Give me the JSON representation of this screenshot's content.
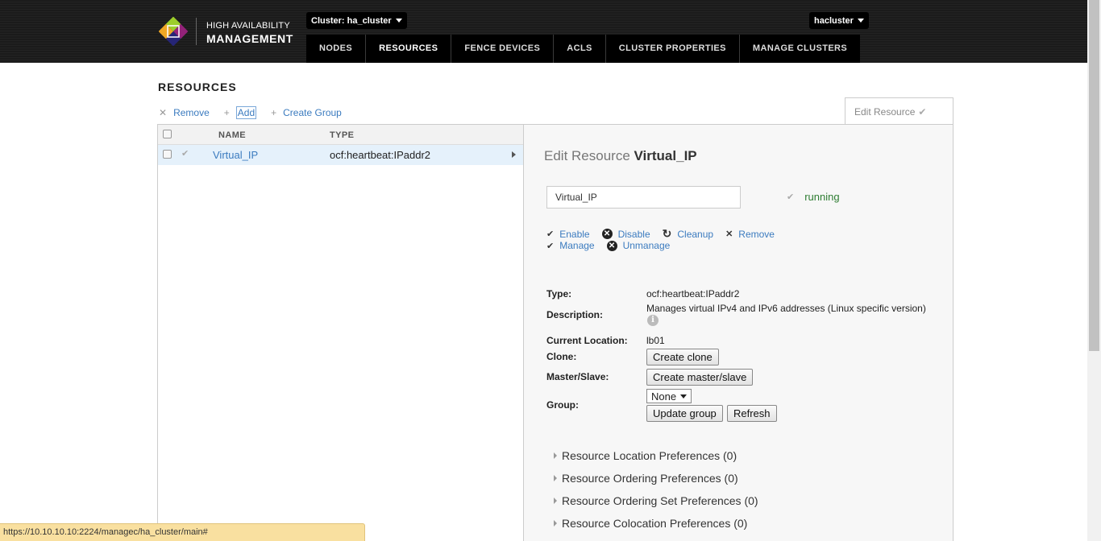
{
  "header": {
    "logo_line1": "HIGH AVAILABILITY",
    "logo_line2": "MANAGEMENT",
    "cluster_label": "Cluster: ha_cluster",
    "user_label": "hacluster",
    "nav": [
      "NODES",
      "RESOURCES",
      "FENCE DEVICES",
      "ACLS",
      "CLUSTER PROPERTIES",
      "MANAGE CLUSTERS"
    ],
    "active_nav": "RESOURCES"
  },
  "page_title": "RESOURCES",
  "actions": {
    "remove": "Remove",
    "add": "Add",
    "create_group": "Create Group"
  },
  "edit_tab": "Edit Resource",
  "table": {
    "headers": {
      "name": "NAME",
      "type": "TYPE"
    },
    "rows": [
      {
        "name": "Virtual_IP",
        "type": "ocf:heartbeat:IPaddr2"
      }
    ]
  },
  "detail": {
    "title_prefix": "Edit Resource",
    "title_name": "Virtual_IP",
    "name_value": "Virtual_IP",
    "status": "running",
    "ops": {
      "enable": "Enable",
      "disable": "Disable",
      "cleanup": "Cleanup",
      "remove": "Remove",
      "manage": "Manage",
      "unmanage": "Unmanage"
    },
    "labels": {
      "type": "Type:",
      "description": "Description:",
      "location": "Current Location:",
      "clone": "Clone:",
      "master": "Master/Slave:",
      "group": "Group:"
    },
    "values": {
      "type": "ocf:heartbeat:IPaddr2",
      "description": "Manages virtual IPv4 and IPv6 addresses (Linux specific version)",
      "location": "lb01"
    },
    "buttons": {
      "create_clone": "Create clone",
      "create_master": "Create master/slave",
      "update_group": "Update group",
      "refresh": "Refresh"
    },
    "group_select": "None",
    "preferences": [
      "Resource Location Preferences (0)",
      "Resource Ordering Preferences (0)",
      "Resource Ordering Set Preferences (0)",
      "Resource Colocation Preferences (0)"
    ]
  },
  "status_url": "https://10.10.10.10:2224/managec/ha_cluster/main#"
}
